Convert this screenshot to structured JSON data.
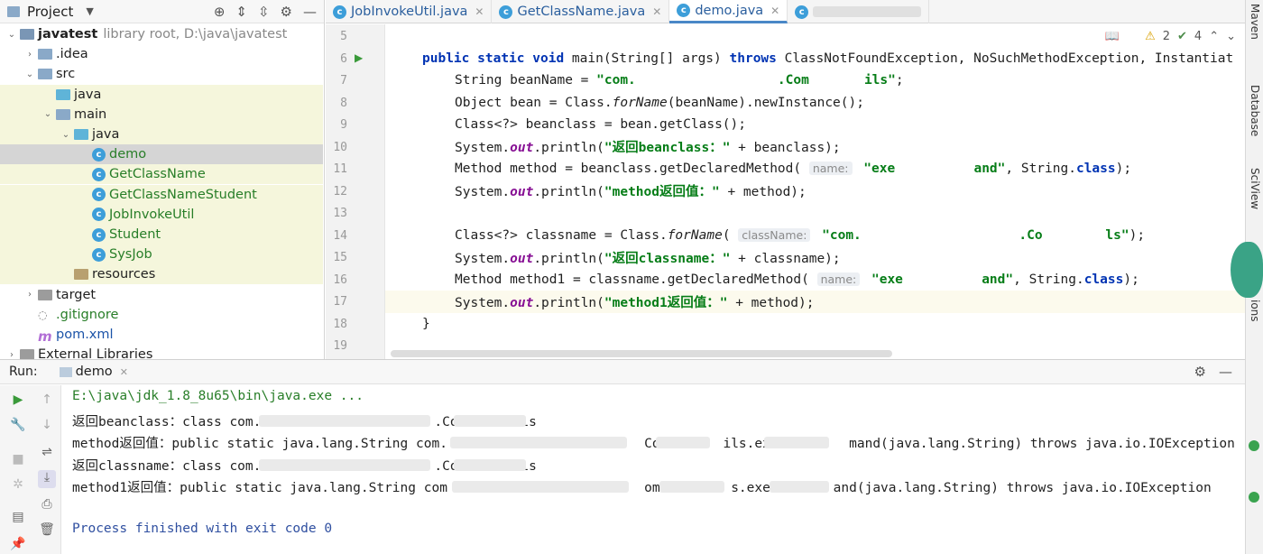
{
  "project_panel": {
    "title": "Project",
    "tree": [
      {
        "label": "javatest",
        "suffix": "library root,  D:\\java\\javatest",
        "level": 0,
        "kind": "module",
        "expanded": true
      },
      {
        "label": ".idea",
        "level": 1,
        "kind": "folder",
        "expanded": false
      },
      {
        "label": "src",
        "level": 1,
        "kind": "folder",
        "expanded": true
      },
      {
        "label": "java",
        "level": 2,
        "kind": "src-folder",
        "expanded": null
      },
      {
        "label": "main",
        "level": 2,
        "kind": "folder",
        "expanded": true
      },
      {
        "label": "java",
        "level": 3,
        "kind": "src-folder",
        "expanded": true
      },
      {
        "label": "demo",
        "level": 4,
        "kind": "class",
        "selected": true
      },
      {
        "label": "GetClassName",
        "level": 4,
        "kind": "class"
      },
      {
        "label": "GetClassNameStudent",
        "level": 4,
        "kind": "class"
      },
      {
        "label": "JobInvokeUtil",
        "level": 4,
        "kind": "class"
      },
      {
        "label": "Student",
        "level": 4,
        "kind": "class"
      },
      {
        "label": "SysJob",
        "level": 4,
        "kind": "class"
      },
      {
        "label": "resources",
        "level": 3,
        "kind": "res-folder"
      },
      {
        "label": "target",
        "level": 1,
        "kind": "folder-gray",
        "expanded": false
      },
      {
        "label": ".gitignore",
        "level": 1,
        "kind": "git"
      },
      {
        "label": "pom.xml",
        "level": 1,
        "kind": "maven"
      },
      {
        "label": "External Libraries",
        "level": 0,
        "kind": "lib",
        "expanded": false
      }
    ]
  },
  "editor_tabs": [
    {
      "label": "JobInvokeUtil.java",
      "active": false
    },
    {
      "label": "GetClassName.java",
      "active": false
    },
    {
      "label": "demo.java",
      "active": true
    },
    {
      "label": "",
      "active": false
    }
  ],
  "inspections": {
    "warnings": "2",
    "checks": "4"
  },
  "right_strip": [
    "Maven",
    "Database",
    "SciView",
    "ions"
  ],
  "code": {
    "line_numbers": [
      "5",
      "6",
      "7",
      "8",
      "9",
      "10",
      "11",
      "12",
      "13",
      "14",
      "15",
      "16",
      "17",
      "18",
      "19"
    ],
    "lines": [
      "",
      "public static void main(String[] args) throws ClassNotFoundException, NoSuchMethodException, Instantiat",
      "String beanName = \"com.                  .Com       ils\";",
      "Object bean = Class.forName(beanName).newInstance();",
      "Class<?> beanclass = bean.getClass();",
      "System.out.println(\"返回beanclass：\" + beanclass);",
      "Method method = beanclass.getDeclaredMethod( name: \"exe          and\", String.class);",
      "System.out.println(\"method返回值：\" + method);",
      "",
      "Class<?> classname = Class.forName( className: \"com.                    .Co        ls\");",
      "System.out.println(\"返回classname：\" + classname);",
      "Method method1 = classname.getDeclaredMethod( name: \"exe          and\", String.class);",
      "System.out.println(\"method1返回值：\" + method);",
      "}",
      ""
    ]
  },
  "run_panel": {
    "label": "Run:",
    "tab": "demo",
    "console": [
      "E:\\java\\jdk_1.8_8u65\\bin\\java.exe ...",
      "返回beanclass：class com.                      .Com       ls",
      "method返回值：public static java.lang.String com.                         Com       ils.exec        mand(java.lang.String) throws java.io.IOException",
      "返回classname：class com.                      .Com       ls",
      "method1返回值：public static java.lang.String com                         omm        s.exe        and(java.lang.String) throws java.io.IOException",
      "",
      "Process finished with exit code 0"
    ]
  }
}
